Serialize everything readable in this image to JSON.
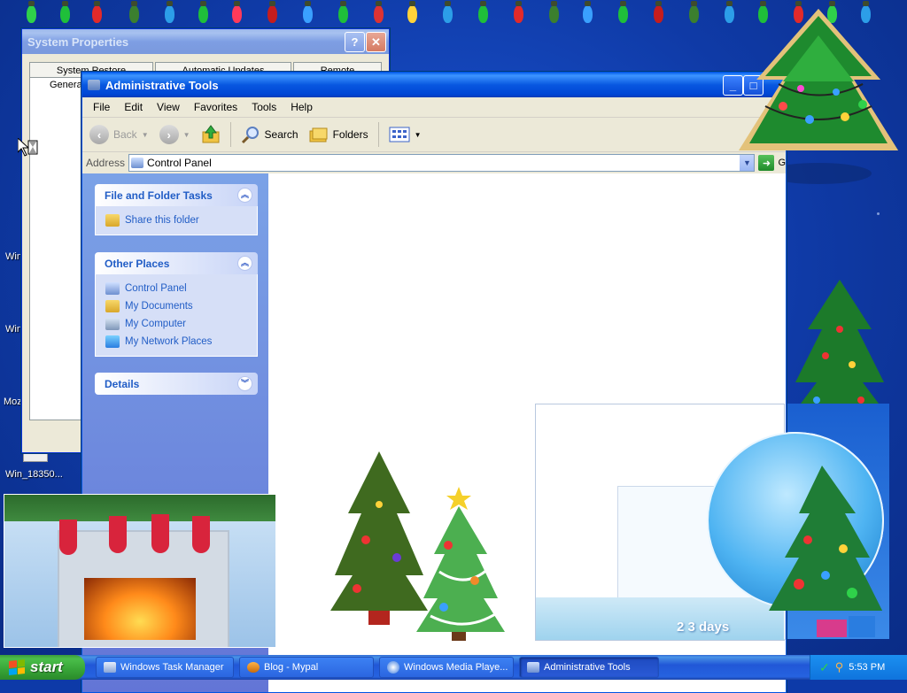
{
  "desktop": {
    "icon_labels": [
      "Win",
      "Win",
      "Moz",
      "Win_18350..."
    ]
  },
  "system_properties": {
    "title": "System Properties",
    "help_btn": "?",
    "close_btn": "✕",
    "tabs": [
      "System Restore",
      "Automatic Updates",
      "Remote"
    ],
    "active_tab": "Genera"
  },
  "explorer": {
    "title": "Administrative Tools",
    "menu": [
      "File",
      "Edit",
      "View",
      "Favorites",
      "Tools",
      "Help"
    ],
    "toolbar": {
      "back": "Back",
      "search": "Search",
      "folders": "Folders"
    },
    "address_label": "Address",
    "address_value": "Control Panel",
    "go_label": "G",
    "file_tasks": {
      "title": "File and Folder Tasks",
      "items": [
        "Share this folder"
      ]
    },
    "other_places": {
      "title": "Other Places",
      "items": [
        "Control Panel",
        "My Documents",
        "My Computer",
        "My Network Places"
      ]
    },
    "details": {
      "title": "Details"
    }
  },
  "taskbar": {
    "start": "start",
    "tasks": [
      "Windows Task Manager",
      "Blog - Mypal",
      "Windows Media Playe...",
      "Administrative Tools"
    ],
    "clock": "5:53 PM"
  },
  "card_text": "2 3 days",
  "colors": {
    "titlebar": "#0058e6",
    "taskbar": "#245edb",
    "start_green": "#3c9a3c",
    "task_pane_blue": "#6e8ddf",
    "link_blue": "#215dc6"
  }
}
